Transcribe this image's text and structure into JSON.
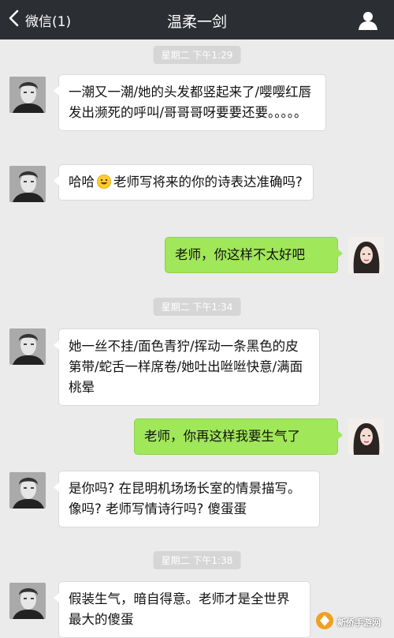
{
  "header": {
    "back_label": "微信(1)",
    "title": "温柔一剑"
  },
  "messages": [
    {
      "type": "timestamp",
      "text": "星期二 下午1:29"
    },
    {
      "type": "in",
      "text": "一潮又一潮/她的头发都竖起来了/嘤嘤红唇发出濒死的呼叫/哥哥哥呀要要还要。。。。。"
    },
    {
      "type": "in",
      "text_before": "哈哈",
      "emoji": "grinning-emoji",
      "text_after": "老师写将来的你的诗表达准确吗?"
    },
    {
      "type": "out",
      "text": "老师，你这样不太好吧"
    },
    {
      "type": "timestamp",
      "text": "星期二 下午1:34"
    },
    {
      "type": "in",
      "text": "她一丝不挂/面色青狞/挥动一条黑色的皮第带/蛇舌一样席卷/她吐出咝咝快意/满面桃晕"
    },
    {
      "type": "out",
      "text": "老师，你再这样我要生气了"
    },
    {
      "type": "in",
      "text": "是你吗? 在昆明机场场长室的情景描写。像吗? 老师写情诗行吗? 傻蛋蛋"
    },
    {
      "type": "timestamp",
      "text": "星期二 下午1:38"
    },
    {
      "type": "in",
      "text": "假装生气，暗自得意。老师才是全世界最大的傻蛋"
    }
  ],
  "watermark": {
    "text": "新侨手游网"
  },
  "colors": {
    "header_bg": "#2b2e33",
    "chat_bg": "#ebebeb",
    "outgoing_bubble": "#a0e759",
    "incoming_bubble": "#ffffff"
  }
}
